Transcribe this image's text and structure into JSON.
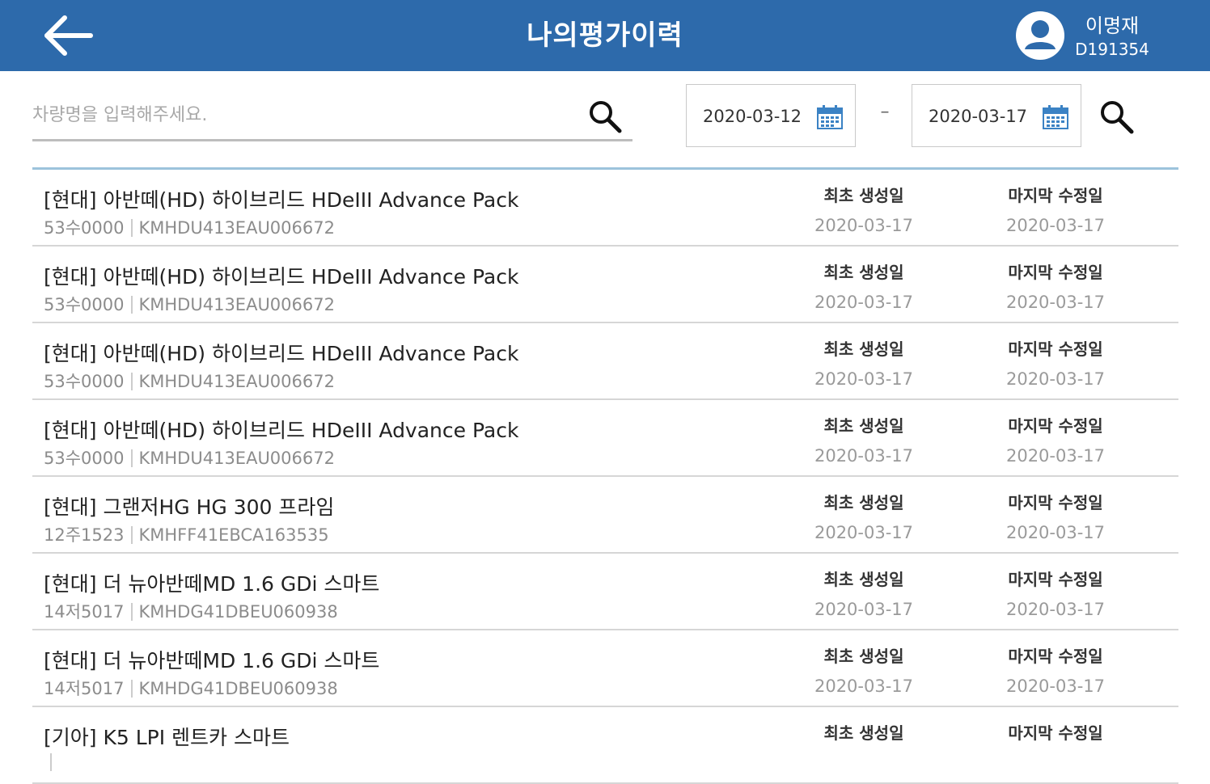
{
  "header": {
    "title": "나의평가이력",
    "user_name": "이명재",
    "user_id": "D191354"
  },
  "search": {
    "placeholder": "차량명을 입력해주세요.",
    "value": ""
  },
  "date_range": {
    "start": "2020-03-12",
    "separator": "–",
    "end": "2020-03-17"
  },
  "labels": {
    "created": "최초 생성일",
    "modified": "마지막 수정일"
  },
  "colors": {
    "header_bg": "#2d6aab",
    "list_top_border": "#9cc3dc",
    "calendar_icon": "#3b82c4"
  },
  "items": [
    {
      "title": "[현대] 아반떼(HD) 하이브리드 HDeIII Advance Pack",
      "plate": "53수0000",
      "vin": "KMHDU413EAU006672",
      "created": "2020-03-17",
      "modified": "2020-03-17"
    },
    {
      "title": "[현대] 아반떼(HD) 하이브리드 HDeIII Advance Pack",
      "plate": "53수0000",
      "vin": "KMHDU413EAU006672",
      "created": "2020-03-17",
      "modified": "2020-03-17"
    },
    {
      "title": "[현대] 아반떼(HD) 하이브리드 HDeIII Advance Pack",
      "plate": "53수0000",
      "vin": "KMHDU413EAU006672",
      "created": "2020-03-17",
      "modified": "2020-03-17"
    },
    {
      "title": "[현대] 아반떼(HD) 하이브리드 HDeIII Advance Pack",
      "plate": "53수0000",
      "vin": "KMHDU413EAU006672",
      "created": "2020-03-17",
      "modified": "2020-03-17"
    },
    {
      "title": "[현대] 그랜저HG HG 300 프라임",
      "plate": "12주1523",
      "vin": "KMHFF41EBCA163535",
      "created": "2020-03-17",
      "modified": "2020-03-17"
    },
    {
      "title": "[현대] 더 뉴아반떼MD 1.6 GDi 스마트",
      "plate": "14저5017",
      "vin": "KMHDG41DBEU060938",
      "created": "2020-03-17",
      "modified": "2020-03-17"
    },
    {
      "title": "[현대] 더 뉴아반떼MD 1.6 GDi 스마트",
      "plate": "14저5017",
      "vin": "KMHDG41DBEU060938",
      "created": "2020-03-17",
      "modified": "2020-03-17"
    },
    {
      "title": "[기아] K5 LPI 렌트카 스마트",
      "plate": "",
      "vin": "",
      "created": "",
      "modified": ""
    }
  ]
}
